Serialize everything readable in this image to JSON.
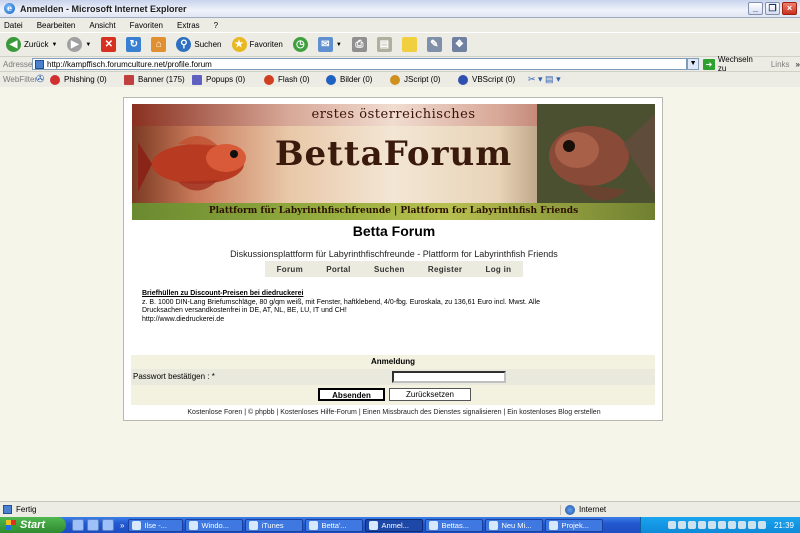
{
  "window": {
    "title": "Anmelden - Microsoft Internet Explorer"
  },
  "menu": [
    "Datei",
    "Bearbeiten",
    "Ansicht",
    "Favoriten",
    "Extras",
    "?"
  ],
  "toolbar": {
    "back_label": "Zurück",
    "search_label": "Suchen",
    "favorites_label": "Favoriten"
  },
  "address": {
    "label": "Adresse",
    "url": "http://kampffisch.forumculture.net/profile.forum",
    "go_label": "Wechseln zu",
    "links_label": "Links"
  },
  "webfilter": {
    "label": "WebFilter",
    "items": [
      {
        "label": "Phishing (0)",
        "color": "#d03030"
      },
      {
        "label": "Banner (175)",
        "color": "#c04040"
      },
      {
        "label": "Popups (0)",
        "color": "#6060c0"
      },
      {
        "label": "Flash (0)",
        "color": "#d04020"
      },
      {
        "label": "Bilder (0)",
        "color": "#2060c0"
      },
      {
        "label": "JScript (0)",
        "color": "#d09020"
      },
      {
        "label": "VBScript (0)",
        "color": "#3050b0"
      }
    ]
  },
  "forum": {
    "banner_sub": "erstes österreichisches",
    "banner_title": "BettaForum",
    "banner_bottom": "Plattform für Labyrinthfischfreunde | Plattform for Labyrinthfish Friends",
    "title": "Betta Forum",
    "description": "Diskussionsplattform für Labyrinthfischfreunde - Plattform for Labyrinthfish Friends",
    "nav": [
      "Forum",
      "Portal",
      "Suchen",
      "Register",
      "Log in"
    ],
    "ad": {
      "headline": "Briefhüllen zu Discount-Preisen bei diedruckerei",
      "line1": "z. B. 1000 DIN-Lang Briefumschläge, 80 g/qm weiß, mit Fenster, haftklebend, 4/0-fbg. Euroskala, zu 136,61 Euro incl. Mwst. Alle",
      "line2": "Drucksachen versandkostenfrei in DE, AT, NL, BE, LU, IT und CH!",
      "line3": "http://www.diedruckerei.de"
    },
    "login": {
      "heading": "Anmeldung",
      "password_label": "Passwort bestätigen : *",
      "password_value": "",
      "submit_label": "Absenden",
      "reset_label": "Zurücksetzen"
    },
    "footer": "Kostenlose Foren | © phpbb | Kostenloses Hilfe-Forum | Einen Missbrauch des Dienstes signalisieren | Ein kostenloses Blog erstellen"
  },
  "status": {
    "left": "Fertig",
    "zone": "Internet"
  },
  "taskbar": {
    "start": "Start",
    "tasks": [
      "Ilse -...",
      "Windo...",
      "iTunes",
      "Betta'...",
      "Anmel...",
      "Bettas...",
      "Neu Mi...",
      "Projek..."
    ],
    "active_index": 4,
    "clock": "21:39"
  }
}
